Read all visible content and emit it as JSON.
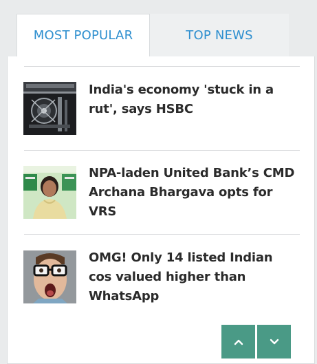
{
  "tabs": [
    {
      "label": "MOST POPULAR",
      "active": true
    },
    {
      "label": "TOP NEWS",
      "active": false
    }
  ],
  "articles": [
    {
      "headline": "India's economy 'stuck in a rut', says HSBC",
      "thumb": "industrial-machinery-image"
    },
    {
      "headline": "NPA-laden United Bank’s CMD Archana Bhargava opts for VRS",
      "thumb": "woman-portrait-image"
    },
    {
      "headline": "OMG! Only 14 listed Indian cos valued higher than WhatsApp",
      "thumb": "surprised-man-image"
    }
  ],
  "controls": {
    "scroll_up": "chevron-up-icon",
    "scroll_down": "chevron-down-icon"
  },
  "colors": {
    "tab_text": "#2e8fcf",
    "headline": "#2b2b2b",
    "button": "#4a9a86",
    "separator": "#d7d9db"
  }
}
